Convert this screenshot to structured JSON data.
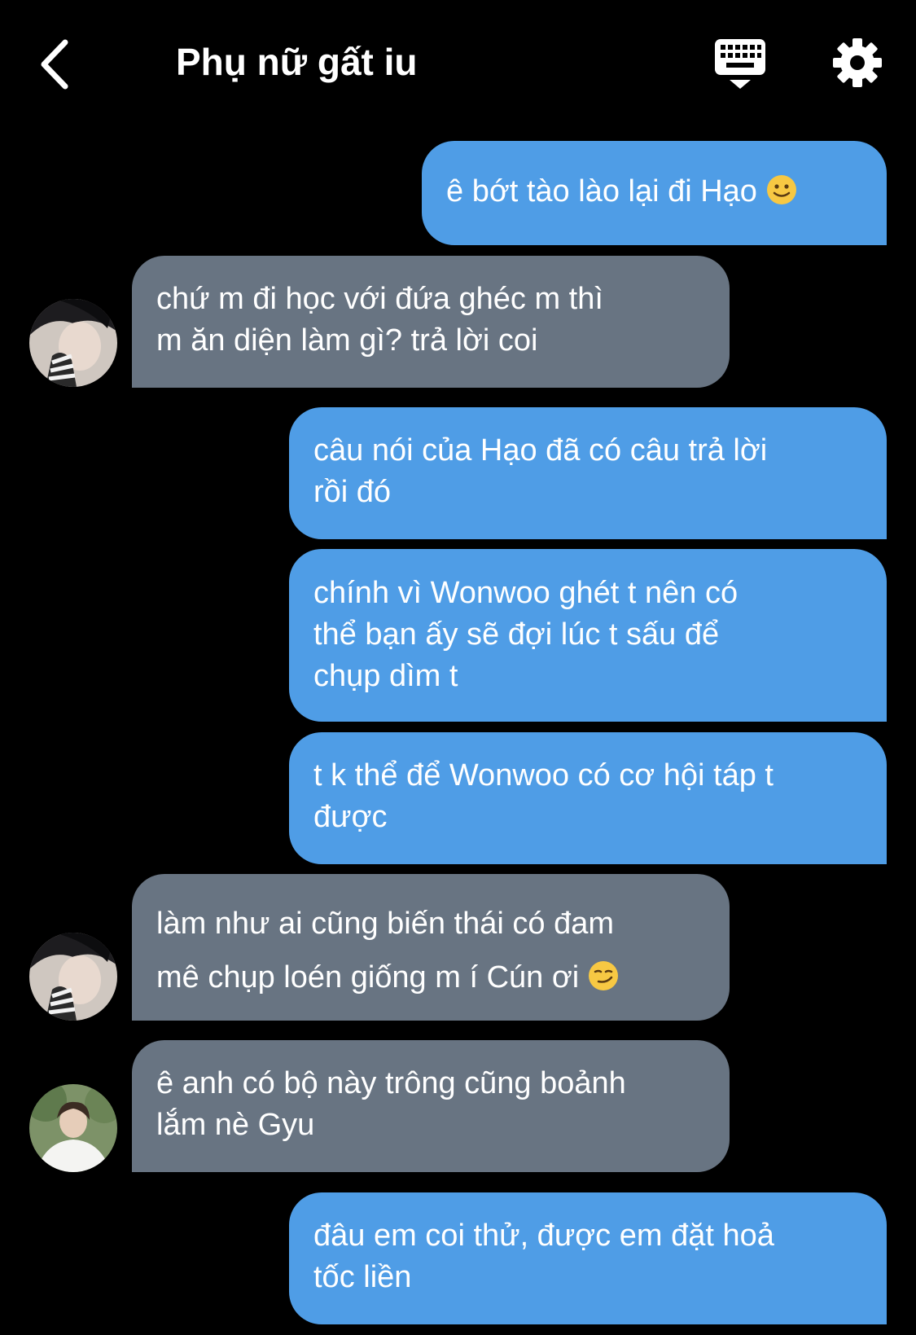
{
  "header": {
    "title": "Phụ nữ gất iu",
    "back_icon": "chevron-left-icon",
    "keyboard_icon": "keyboard-hide-icon",
    "settings_icon": "gear-icon"
  },
  "colors": {
    "background": "#000000",
    "outgoing_bubble": "#4f9de6",
    "incoming_bubble": "#687482",
    "text": "#ffffff"
  },
  "messages": [
    {
      "side": "out",
      "lines": [
        "ê bớt tào lào lại đi Hạo"
      ],
      "emoji": "slightly-smiling-face"
    },
    {
      "side": "in",
      "avatar": "avatar-1",
      "lines": [
        "chứ m đi học với đứa ghéc m thì",
        "m ăn diện làm gì? trả lời coi"
      ]
    },
    {
      "side": "out",
      "lines": [
        "câu nói của Hạo đã có câu trả lời",
        "rồi đó"
      ]
    },
    {
      "side": "out",
      "lines": [
        "chính vì Wonwoo ghét t nên có",
        "thể bạn ấy sẽ đợi lúc t sấu để",
        "chụp dìm t"
      ]
    },
    {
      "side": "out",
      "lines": [
        "t k thể để Wonwoo có cơ hội táp t",
        "được"
      ]
    },
    {
      "side": "in",
      "avatar": "avatar-1",
      "lines": [
        "làm như ai cũng biến thái có đam",
        "mê chụp loén giống m í Cún ơi"
      ],
      "emoji": "smirking-face"
    },
    {
      "side": "in",
      "avatar": "avatar-2",
      "lines": [
        "ê anh có bộ này trông cũng boảnh",
        "lắm nè Gyu"
      ]
    },
    {
      "side": "out",
      "lines": [
        "đâu em coi thử, được em đặt hoả",
        "tốc liền"
      ]
    }
  ]
}
